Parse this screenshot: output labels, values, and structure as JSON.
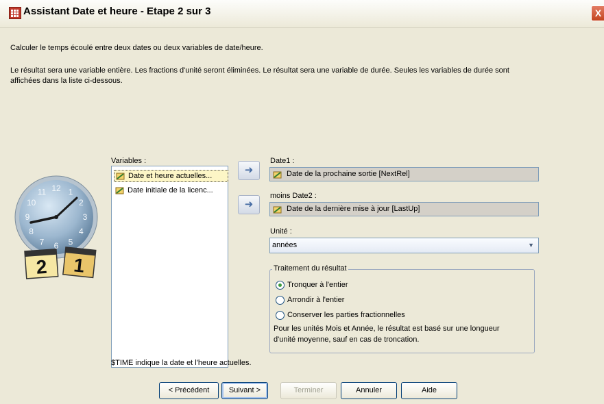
{
  "window": {
    "title": "Assistant Date et heure - Etape 2 sur 3",
    "close_label": "X"
  },
  "description": {
    "line1": "Calculer le temps écoulé entre deux dates ou deux variables de date/heure.",
    "line2": "Le résultat sera une variable entière. Les fractions d'unité seront éliminées. Le résultat sera une variable de durée. Seules les variables de durée sont",
    "line3": "affichées dans la liste ci-dessous."
  },
  "variables": {
    "label": "Variables :",
    "items": [
      {
        "label": "Date et heure actuelles...",
        "selected": true
      },
      {
        "label": "Date initiale de la licenc...",
        "selected": false
      }
    ],
    "note": "$TIME indique la date et l'heure actuelles."
  },
  "date1": {
    "label": "Date1 :",
    "value": "Date de la prochaine sortie [NextRel]"
  },
  "date2": {
    "label": "moins Date2 :",
    "value": "Date de la dernière mise à jour [LastUp]"
  },
  "unit": {
    "label": "Unité :",
    "value": "années"
  },
  "result_group": {
    "title": "Traitement du résultat",
    "options": [
      {
        "label": "Tronquer à l'entier",
        "selected": true
      },
      {
        "label": "Arrondir à l'entier",
        "selected": false
      },
      {
        "label": "Conserver les parties fractionnelles",
        "selected": false
      }
    ],
    "note_line1": "Pour les unités Mois et Année, le résultat est basé sur une longueur",
    "note_line2": "d'unité moyenne, sauf en cas de troncation."
  },
  "buttons": {
    "previous": "< Précédent",
    "next": "Suivant >",
    "finish": "Terminer",
    "cancel": "Annuler",
    "help": "Aide"
  },
  "clock": {
    "numbers": [
      "12",
      "1",
      "2",
      "3",
      "4",
      "5",
      "6",
      "7",
      "8",
      "9",
      "10",
      "11"
    ],
    "calendar_left": "2",
    "calendar_right": "1"
  }
}
